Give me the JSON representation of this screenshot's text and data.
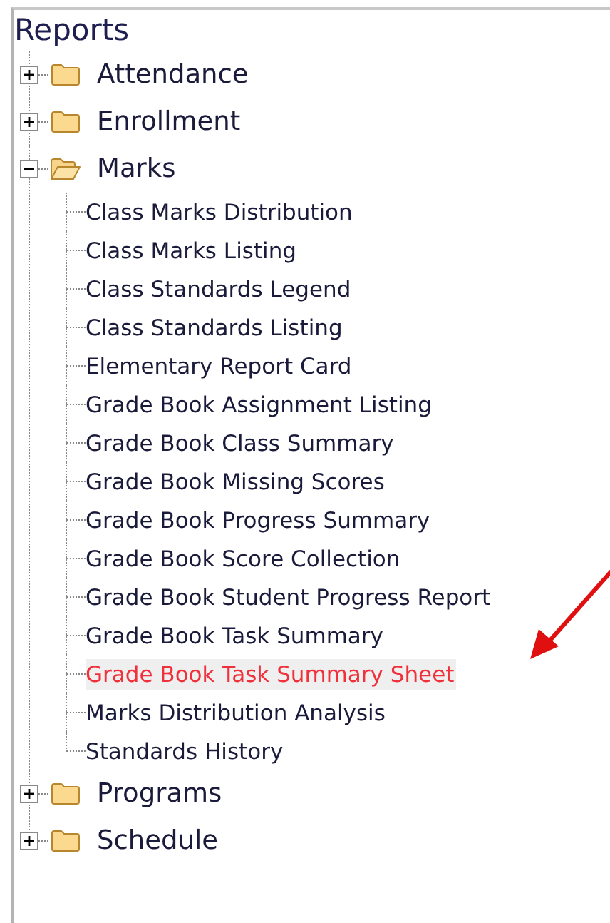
{
  "title": "Reports",
  "folders": [
    {
      "label": "Attendance",
      "expanded": false
    },
    {
      "label": "Enrollment",
      "expanded": false
    },
    {
      "label": "Marks",
      "expanded": true,
      "children": [
        {
          "label": "Class Marks Distribution",
          "selected": false
        },
        {
          "label": "Class Marks Listing",
          "selected": false
        },
        {
          "label": "Class Standards Legend",
          "selected": false
        },
        {
          "label": "Class Standards Listing",
          "selected": false
        },
        {
          "label": "Elementary Report Card",
          "selected": false
        },
        {
          "label": "Grade Book Assignment Listing",
          "selected": false
        },
        {
          "label": "Grade Book Class Summary",
          "selected": false
        },
        {
          "label": "Grade Book Missing Scores",
          "selected": false
        },
        {
          "label": "Grade Book Progress Summary",
          "selected": false
        },
        {
          "label": "Grade Book Score Collection",
          "selected": false
        },
        {
          "label": "Grade Book Student Progress Report",
          "selected": false
        },
        {
          "label": "Grade Book Task Summary",
          "selected": false
        },
        {
          "label": "Grade Book Task Summary Sheet",
          "selected": true
        },
        {
          "label": "Marks Distribution Analysis",
          "selected": false
        },
        {
          "label": "Standards History",
          "selected": false
        }
      ]
    },
    {
      "label": "Programs",
      "expanded": false
    },
    {
      "label": "Schedule",
      "expanded": false
    }
  ]
}
